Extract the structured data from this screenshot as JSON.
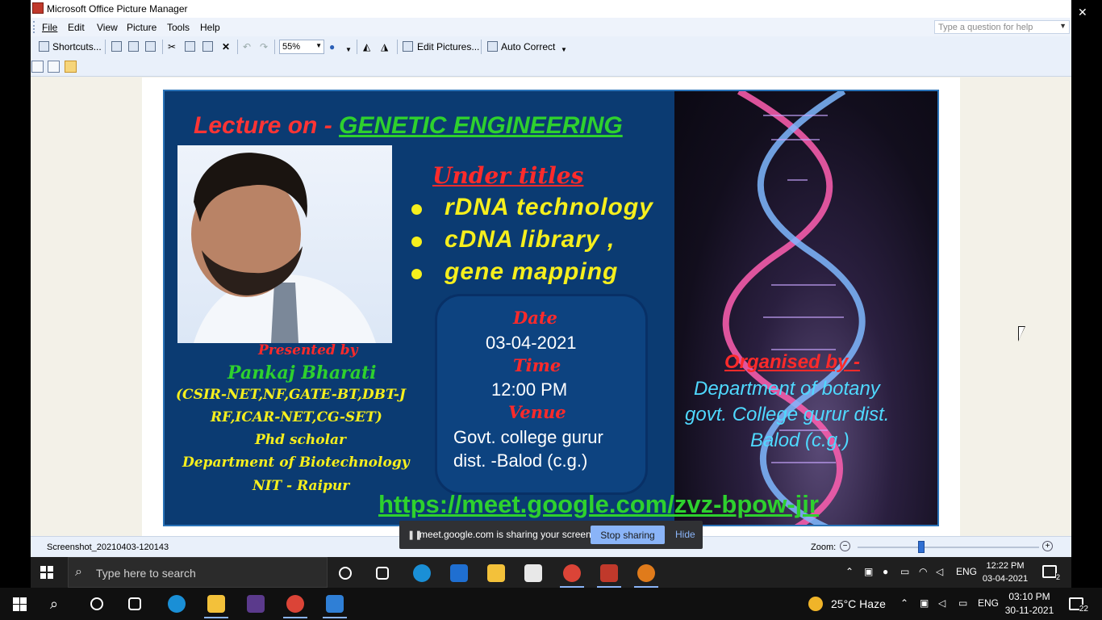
{
  "window": {
    "title": "Microsoft Office Picture Manager",
    "help_placeholder": "Type a question for help"
  },
  "menu": [
    "File",
    "Edit",
    "View",
    "Picture",
    "Tools",
    "Help"
  ],
  "toolbar": {
    "shortcuts_label": "Shortcuts...",
    "zoom_value": "55%",
    "edit_pictures_label": "Edit Pictures...",
    "auto_correct_label": "Auto Correct"
  },
  "poster": {
    "lecture_prefix": "Lecture on - ",
    "lecture_topic": "GENETIC ENGINEERING",
    "under_titles": "Under titles",
    "topics": [
      "rDNA technology",
      "cDNA library ,",
      "gene mapping"
    ],
    "date_label": "Date",
    "date_value": "03-04-2021",
    "time_label": "Time",
    "time_value": "12:00 PM",
    "venue_label": "Venue",
    "venue_line1": "Govt.  college  gurur",
    "venue_line2": "dist. -Balod (c.g.)",
    "presented_by": "Presented by",
    "presenter_name": "Pankaj Bharati",
    "credentials_1": "(CSIR-NET,NF,GATE-BT,DBT-J",
    "credentials_2": "RF,ICAR-NET,CG-SET)",
    "role": "Phd scholar",
    "department": "Department of Biotechnology",
    "institute": "NIT - Raipur",
    "organised_by": "Organised by -",
    "org_line1": "Department of botany",
    "org_line2": "govt. College gurur dist.",
    "org_line3": "Balod (c.g.)",
    "meet_link": "https://meet.google.com/zvz-bpow-jir"
  },
  "status": {
    "filename": "Screenshot_20210403-120143",
    "zoom_label": "Zoom:",
    "zoom_fraction": 0.35
  },
  "sharing": {
    "message": "meet.google.com is sharing your screen.",
    "stop_label": "Stop sharing",
    "hide_label": "Hide"
  },
  "inner_taskbar": {
    "search_placeholder": "Type here to search",
    "lang": "ENG",
    "time": "12:22 PM",
    "date": "03-04-2021",
    "notifications": "2"
  },
  "outer_taskbar": {
    "weather": "25°C  Haze",
    "lang": "ENG",
    "time": "03:10 PM",
    "date": "30-11-2021",
    "notifications": "22"
  },
  "colors": {
    "poster_bg": "#0b3b72",
    "accent_green": "#2ed12e",
    "accent_red": "#ff2a2a",
    "accent_yellow": "#f6ef1d",
    "share_button": "#8ab4f8"
  }
}
